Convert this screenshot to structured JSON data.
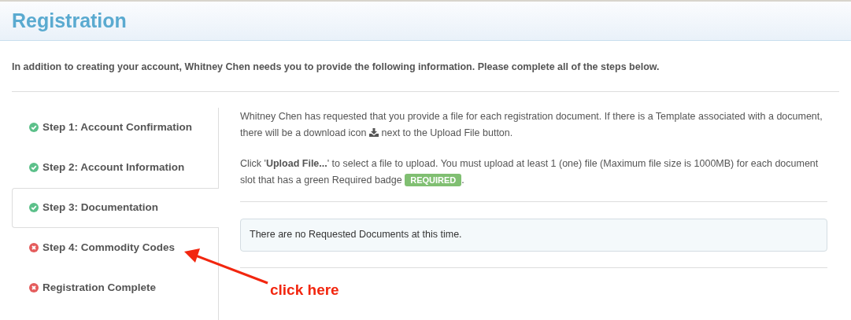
{
  "header": {
    "title": "Registration"
  },
  "intro": "In addition to creating your account, Whitney Chen needs you to provide the following information. Please complete all of the steps below.",
  "steps": [
    {
      "label": "Step 1: Account Confirmation",
      "complete": true,
      "selected": false
    },
    {
      "label": "Step 2: Account Information",
      "complete": true,
      "selected": false
    },
    {
      "label": "Step 3: Documentation",
      "complete": true,
      "selected": true
    },
    {
      "label": "Step 4: Commodity Codes",
      "complete": false,
      "selected": false
    },
    {
      "label": "Registration Complete",
      "complete": false,
      "selected": false
    }
  ],
  "content": {
    "paragraph_1": {
      "before_icon": "Whitney Chen has requested that you provide a file for each registration document. If there is a Template associated with a document, there will be a download icon",
      "after_icon": "next to the Upload File button."
    },
    "paragraph_2": {
      "before_badge": "Click '**Upload File...**' to select a file to upload. You must upload at least 1 (one) file (Maximum file size is 1000MB) for each document slot that has a green Required badge",
      "badge": "REQUIRED",
      "after_badge": "."
    },
    "notice": "There are no Requested Documents at this time."
  },
  "annotation": {
    "text": "click here"
  }
}
